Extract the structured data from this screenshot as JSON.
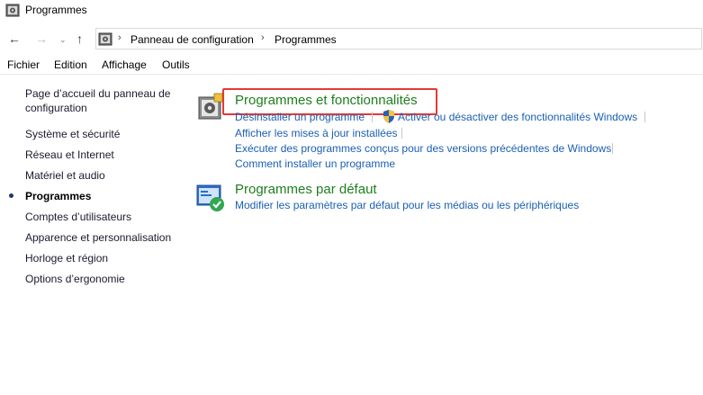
{
  "window": {
    "title": "Programmes"
  },
  "address": {
    "segments": [
      "Panneau de configuration",
      "Programmes"
    ],
    "separator": "›"
  },
  "menu": {
    "items": [
      "Fichier",
      "Edition",
      "Affichage",
      "Outils"
    ]
  },
  "sidebar": {
    "home": "Page d’accueil du panneau de configuration",
    "items": [
      {
        "label": "Système et sécurité"
      },
      {
        "label": "Réseau et Internet"
      },
      {
        "label": "Matériel et audio"
      },
      {
        "label": "Programmes",
        "current": true
      },
      {
        "label": "Comptes d’utilisateurs"
      },
      {
        "label": "Apparence et personnalisation"
      },
      {
        "label": "Horloge et région"
      },
      {
        "label": "Options d’ergonomie"
      }
    ]
  },
  "main": {
    "sections": [
      {
        "title": "Programmes et fonctionnalités",
        "icon": "programs-features-icon",
        "links": [
          "Désinstaller un programme",
          "Activer ou désactiver des fonctionnalités Windows",
          "Afficher les mises à jour installées",
          "Exécuter des programmes conçus pour des versions précédentes de Windows",
          "Comment installer un programme"
        ]
      },
      {
        "title": "Programmes par défaut",
        "icon": "default-programs-icon",
        "links": [
          "Modifier les paramètres par défaut pour les médias ou les périphériques"
        ]
      }
    ]
  },
  "colors": {
    "category_title": "#1e7e1e",
    "link": "#1a5fb4",
    "highlight_box": "#e53935"
  }
}
